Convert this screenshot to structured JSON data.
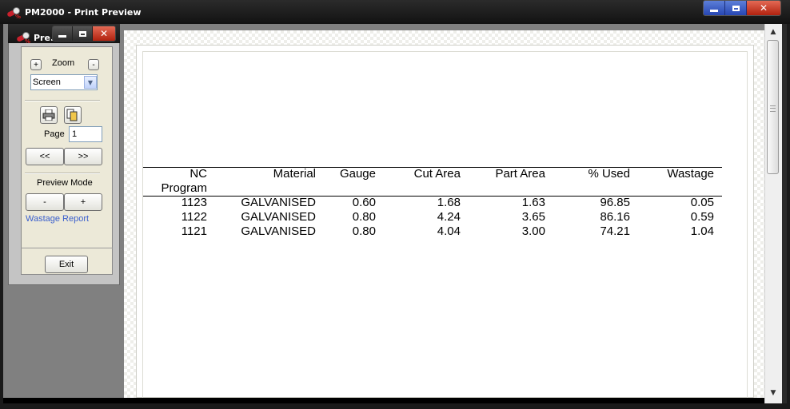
{
  "window": {
    "title": "PM2000 - Print Preview"
  },
  "tool_window": {
    "title": "Pre...",
    "zoom": {
      "label": "Zoom",
      "plus": "+",
      "minus": "-",
      "select_value": "Screen"
    },
    "page": {
      "label": "Page",
      "value": "1"
    },
    "nav": {
      "prev": "<<",
      "next": ">>"
    },
    "preview_mode": {
      "label": "Preview Mode",
      "minus": "-",
      "plus": "+"
    },
    "report_link": "Wastage Report",
    "exit": "Exit"
  },
  "report": {
    "headers": {
      "nc": "NC",
      "program": "Program",
      "material": "Material",
      "gauge": "Gauge",
      "cut_area": "Cut Area",
      "part_area": "Part Area",
      "pct_used": "% Used",
      "wastage": "Wastage"
    },
    "rows": [
      {
        "nc": "1123",
        "material": "GALVANISED",
        "gauge": "0.60",
        "cut_area": "1.68",
        "part_area": "1.63",
        "pct_used": "96.85",
        "wastage": "0.05"
      },
      {
        "nc": "1122",
        "material": "GALVANISED",
        "gauge": "0.80",
        "cut_area": "4.24",
        "part_area": "3.65",
        "pct_used": "86.16",
        "wastage": "0.59"
      },
      {
        "nc": "1121",
        "material": "GALVANISED",
        "gauge": "0.80",
        "cut_area": "4.04",
        "part_area": "3.00",
        "pct_used": "74.21",
        "wastage": "1.04"
      }
    ]
  },
  "colors": {
    "accent_link": "#3a5fcd",
    "close_button": "#c8321b",
    "caption_button": "#3556c4"
  }
}
